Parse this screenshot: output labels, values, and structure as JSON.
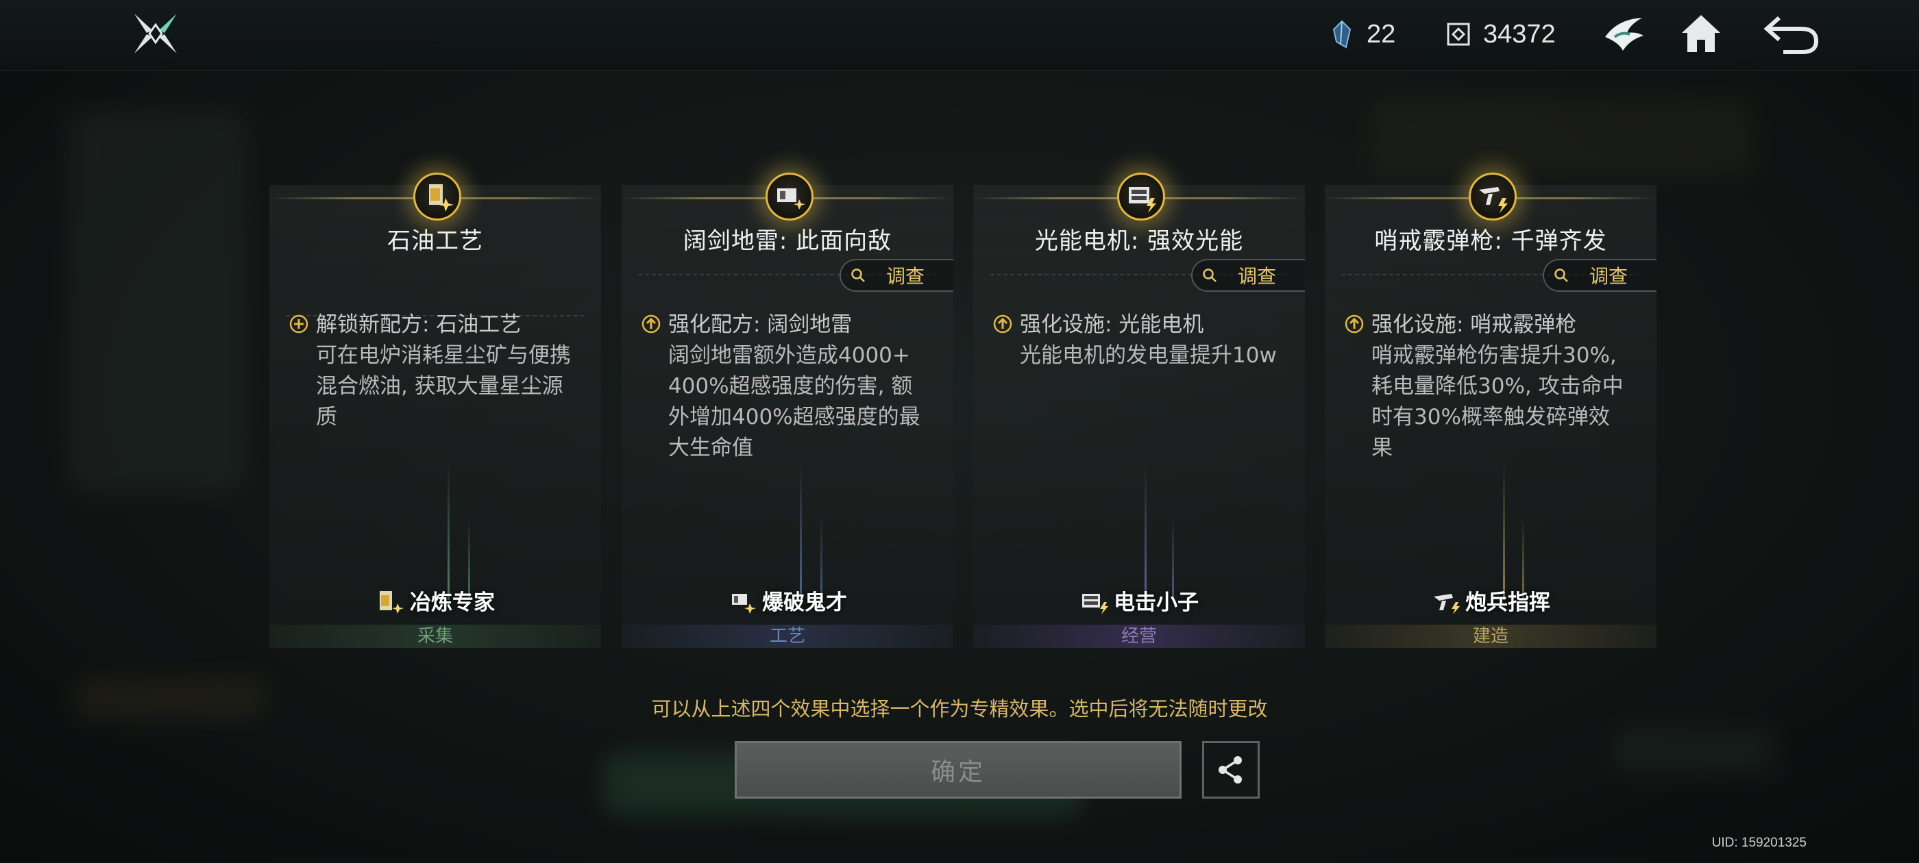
{
  "topbar": {
    "currency_1": {
      "icon": "crystal-shard-icon",
      "value": "22"
    },
    "currency_2": {
      "icon": "cube-token-icon",
      "value": "34372"
    }
  },
  "cards": [
    {
      "title": "石油工艺",
      "investigate_label": "",
      "effect_icon": "plus-circle-icon",
      "effect_head": "解锁新配方: 石油工艺",
      "effect_lines": [
        "可在电炉消耗星尘矿与便携",
        "混合燃油, 获取大量星尘源",
        "质"
      ],
      "role_name": "冶炼专家",
      "category": "采集",
      "category_color": "#6fa27a"
    },
    {
      "title": "阔剑地雷: 此面向敌",
      "investigate_label": "调查",
      "effect_icon": "upgrade-arrow-icon",
      "effect_head": "强化配方: 阔剑地雷",
      "effect_lines": [
        "阔剑地雷额外造成4000+",
        "400%超感强度的伤害, 额",
        "外增加400%超感强度的最",
        "大生命值"
      ],
      "role_name": "爆破鬼才",
      "category": "工艺",
      "category_color": "#6f86b4"
    },
    {
      "title": "光能电机: 强效光能",
      "investigate_label": "调查",
      "effect_icon": "upgrade-arrow-icon",
      "effect_head": "强化设施: 光能电机",
      "effect_lines": [
        "光能电机的发电量提升10w"
      ],
      "role_name": "电击小子",
      "category": "经营",
      "category_color": "#8c7bb8"
    },
    {
      "title": "哨戒霰弹枪: 千弹齐发",
      "investigate_label": "调查",
      "effect_icon": "upgrade-arrow-icon",
      "effect_head": "强化设施: 哨戒霰弹枪",
      "effect_lines": [
        "哨戒霰弹枪伤害提升30%,",
        "耗电量降低30%, 攻击命中",
        "时有30%概率触发碎弹效",
        "果"
      ],
      "role_name": "炮兵指挥",
      "category": "建造",
      "category_color": "#b8a565"
    }
  ],
  "hint": "可以从上述四个效果中选择一个作为专精效果。选中后将无法随时更改",
  "confirm_label": "确定",
  "uid": "UID: 159201325",
  "colors": {
    "gold": "#e2b83d",
    "hint": "#d9b865"
  }
}
